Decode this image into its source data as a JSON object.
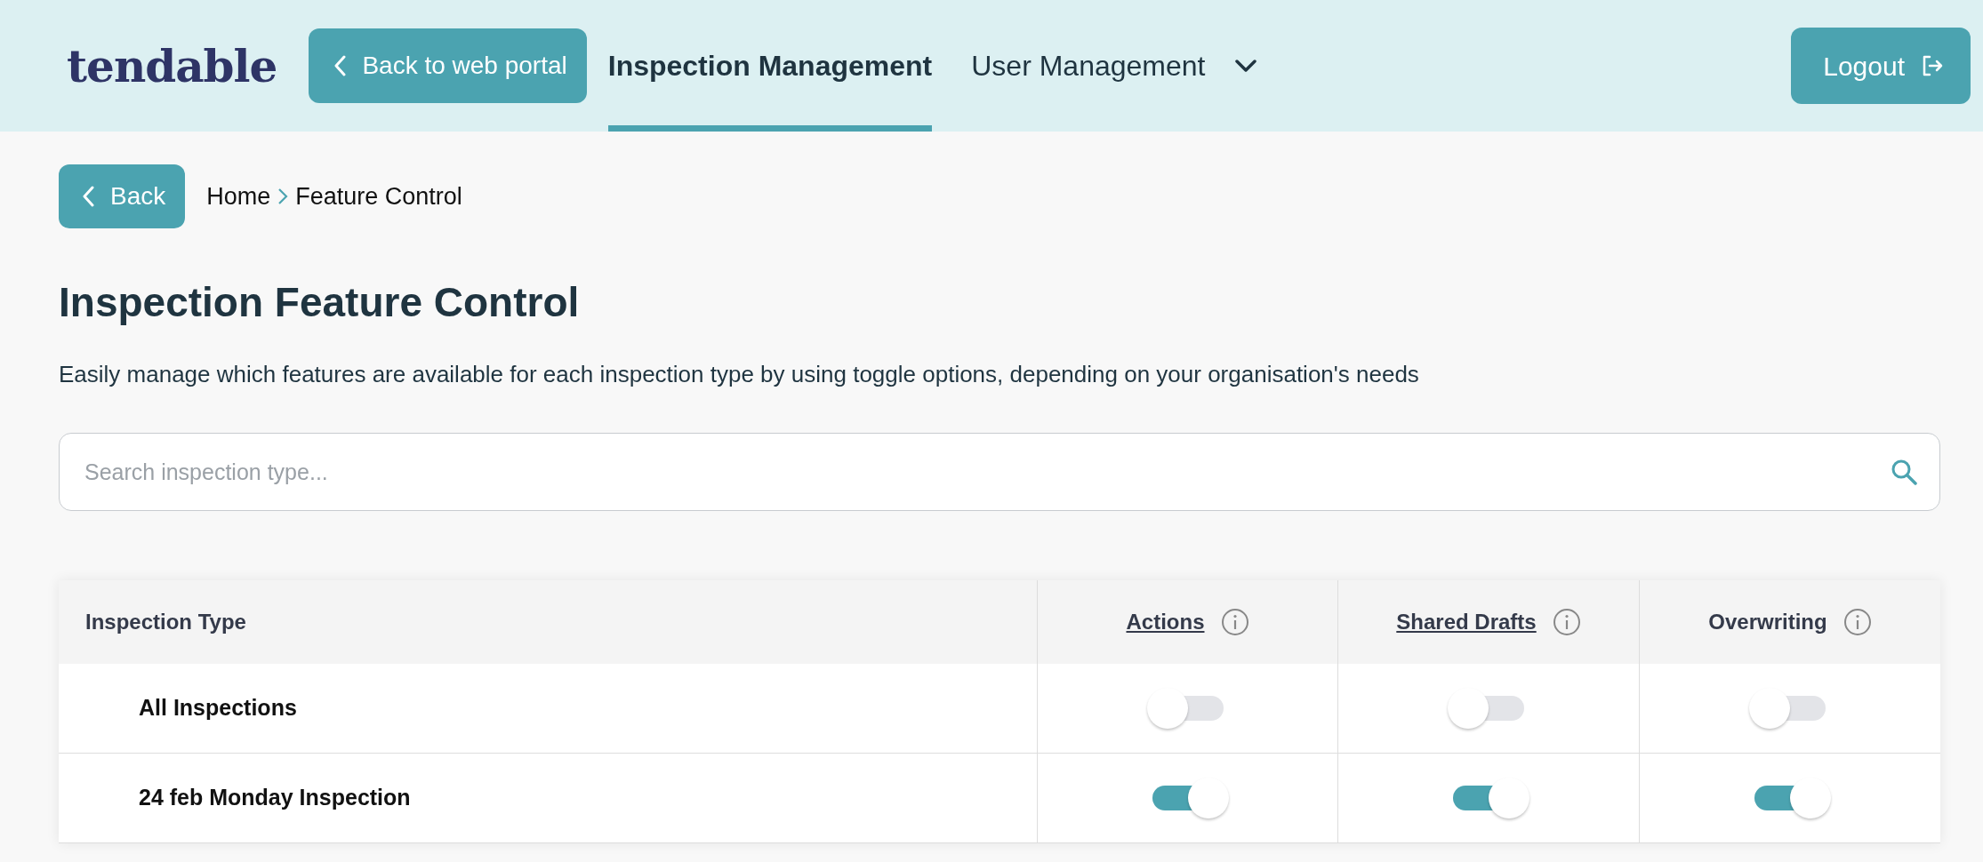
{
  "header": {
    "logo": "tendable",
    "back_button": "Back to web portal",
    "nav": [
      {
        "label": "Inspection Management",
        "selected": true,
        "dropdown": false
      },
      {
        "label": "User Management",
        "selected": false,
        "dropdown": true
      }
    ],
    "logout": "Logout"
  },
  "breadcrumb": {
    "back_button": "Back",
    "items": [
      "Home",
      "Feature Control"
    ]
  },
  "title": "Inspection Feature Control",
  "description": "Easily manage which features are available for each inspection type by using toggle options, depending on your organisation's needs",
  "search": {
    "placeholder": "Search inspection type..."
  },
  "table": {
    "columns": [
      {
        "label": "Inspection Type",
        "underlined": false,
        "info": false
      },
      {
        "label": "Actions",
        "underlined": true,
        "info": true
      },
      {
        "label": "Shared Drafts",
        "underlined": true,
        "info": true
      },
      {
        "label": "Overwriting",
        "underlined": false,
        "info": true
      }
    ],
    "rows": [
      {
        "name": "All Inspections",
        "toggles": [
          false,
          false,
          false
        ]
      },
      {
        "name": "24 feb Monday Inspection",
        "toggles": [
          true,
          true,
          true
        ]
      }
    ]
  }
}
